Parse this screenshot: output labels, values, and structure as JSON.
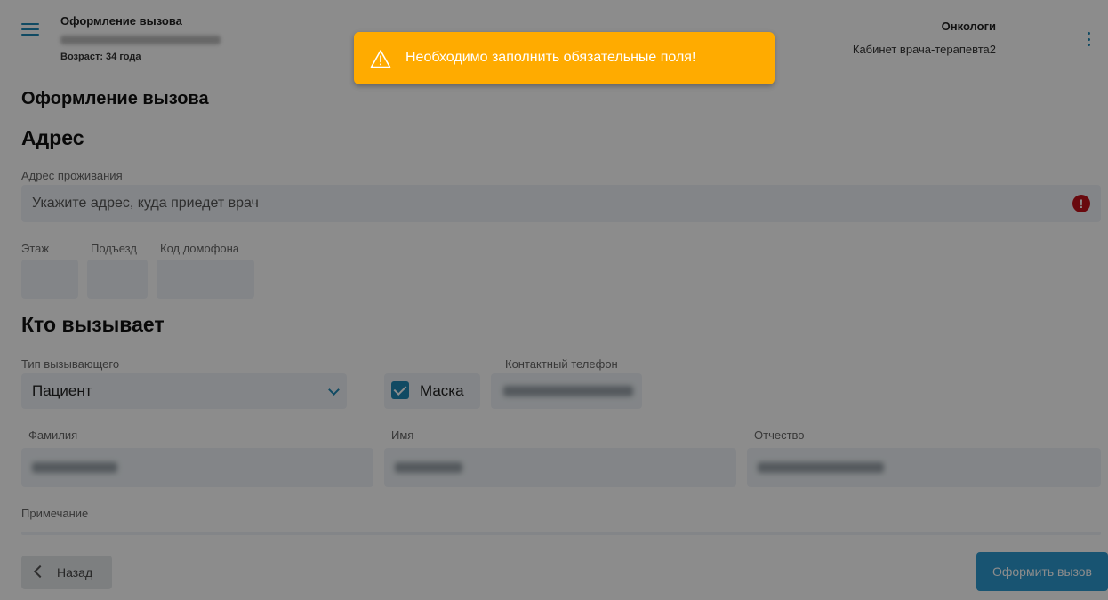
{
  "header": {
    "title": "Оформление вызова",
    "age": "Возраст: 34 года",
    "department": "Онкологи",
    "cabinet": "Кабинет врача-терапевта2"
  },
  "page": {
    "title": "Оформление вызова"
  },
  "address": {
    "section_title": "Адрес",
    "residence_label": "Адрес проживания",
    "residence_placeholder": "Укажите адрес, куда приедет врач",
    "floor_label": "Этаж",
    "entrance_label": "Подъезд",
    "intercom_label": "Код домофона"
  },
  "caller": {
    "section_title": "Кто вызывает",
    "caller_type_label": "Тип вызывающего",
    "caller_type_value": "Пациент",
    "mask_label": "Маска",
    "mask_checked": true,
    "phone_label": "Контактный телефон",
    "surname_label": "Фамилия",
    "name_label": "Имя",
    "patronymic_label": "Отчество",
    "note_label": "Примечание"
  },
  "actions": {
    "back_label": "Назад",
    "submit_label": "Оформить вызов"
  },
  "toast": {
    "message": "Необходимо заполнить обязательные поля!",
    "icon": "warning-icon",
    "color": "#ffab00"
  },
  "colors": {
    "accent": "#1e88b5",
    "error": "#c0111b",
    "submit": "#2c9ad0"
  }
}
